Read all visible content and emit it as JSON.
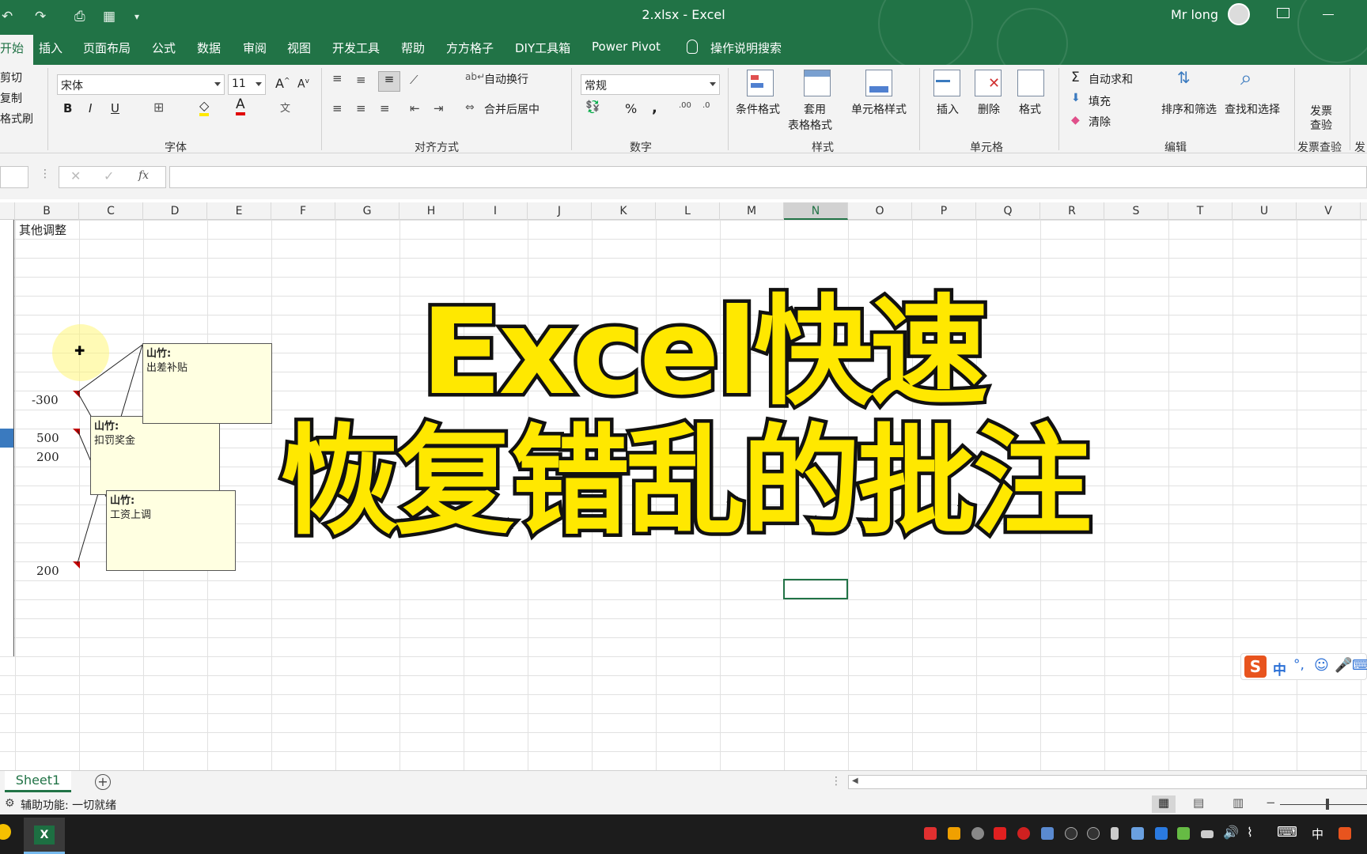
{
  "window": {
    "title": "2.xlsx  -  Excel",
    "user": "Mr long"
  },
  "tabs": [
    {
      "label": "开始"
    },
    {
      "label": "插入"
    },
    {
      "label": "页面布局"
    },
    {
      "label": "公式"
    },
    {
      "label": "数据"
    },
    {
      "label": "审阅"
    },
    {
      "label": "视图"
    },
    {
      "label": "开发工具"
    },
    {
      "label": "帮助"
    },
    {
      "label": "方方格子"
    },
    {
      "label": "DIY工具箱"
    },
    {
      "label": "Power Pivot"
    },
    {
      "label": "操作说明搜索"
    }
  ],
  "ribbon": {
    "clipboard": {
      "cut": "剪切",
      "copy": "复制",
      "format_painter": "格式刷"
    },
    "font": {
      "name": "宋体",
      "size": "11",
      "bold": "B",
      "italic": "I",
      "underline": "U",
      "group": "字体"
    },
    "alignment": {
      "wrap": "自动换行",
      "merge": "合并后居中",
      "group": "对齐方式"
    },
    "number": {
      "format": "常规",
      "percent": "%",
      "comma": ",",
      "group": "数字"
    },
    "styles": {
      "conditional": "条件格式",
      "table_line1": "套用",
      "table_line2": "表格格式",
      "cell_styles": "单元格样式",
      "group": "样式"
    },
    "cells": {
      "insert": "插入",
      "delete": "删除",
      "format": "格式",
      "group": "单元格"
    },
    "editing": {
      "autosum": "自动求和",
      "fill": "填充",
      "clear": "清除",
      "sort": "排序和筛选",
      "find": "查找和选择",
      "group": "编辑"
    },
    "invoice": {
      "line1": "发票",
      "line2": "查验",
      "group": "发票查验",
      "cut_group": "发"
    }
  },
  "formula_bar": {
    "fx": "fx",
    "value": ""
  },
  "columns": [
    "B",
    "C",
    "D",
    "E",
    "F",
    "G",
    "H",
    "I",
    "J",
    "K",
    "L",
    "M",
    "N",
    "O",
    "P",
    "Q",
    "R",
    "S",
    "T",
    "U",
    "V"
  ],
  "selected_column": "N",
  "cells": {
    "header": "其他调整",
    "v1": "-300",
    "v2": "500",
    "v3": "200",
    "v4": "200"
  },
  "comments": [
    {
      "author": "山竹:",
      "text": "出差补贴"
    },
    {
      "author": "山竹:",
      "text": "扣罚奖金"
    },
    {
      "author": "山竹:",
      "text": "工资上调"
    }
  ],
  "overlay": {
    "line1": "Excel快速",
    "line2": "恢复错乱的批注"
  },
  "sheet": {
    "name": "Sheet1",
    "add": "+"
  },
  "status": {
    "text": "辅助功能: 一切就绪"
  },
  "taskbar": {
    "clock": "中"
  },
  "colors": {
    "excel_green": "#217346",
    "overlay_yellow": "#ffe800",
    "comment_bg": "#ffffe1"
  }
}
